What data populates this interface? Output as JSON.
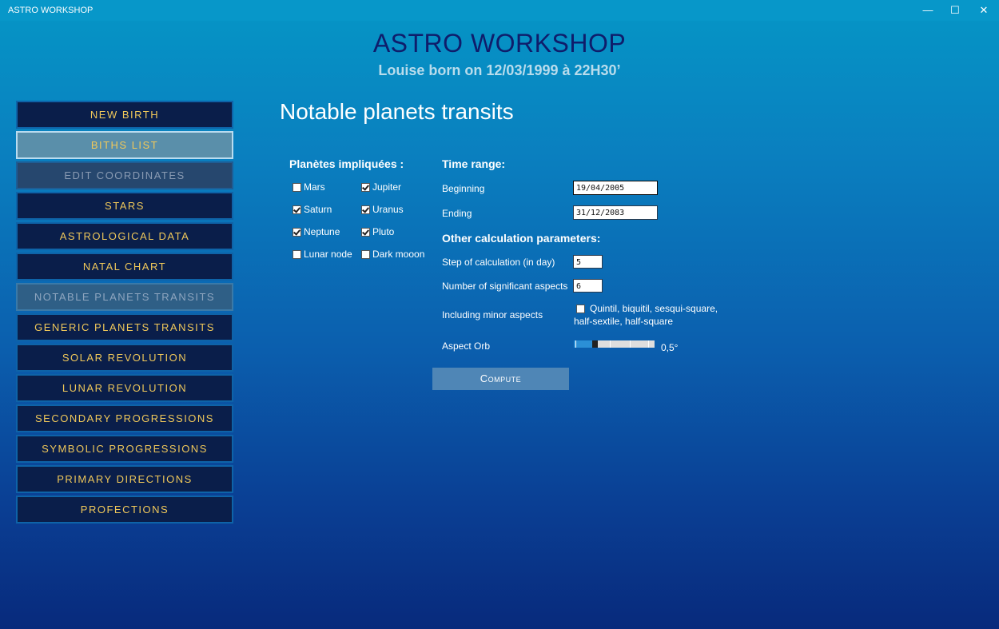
{
  "window": {
    "title": "ASTRO WORKSHOP",
    "minimize": "—",
    "maximize": "☐",
    "close": "✕"
  },
  "header": {
    "title": "ASTRO WORKSHOP",
    "subtitle": "Louise born on 12/03/1999 à 22H30’"
  },
  "nav": {
    "items": [
      {
        "label": "NEW BIRTH",
        "state": "normal"
      },
      {
        "label": "BITHS LIST",
        "state": "selected"
      },
      {
        "label": "EDIT COORDINATES",
        "state": "disabled"
      },
      {
        "label": "STARS",
        "state": "normal"
      },
      {
        "label": "ASTROLOGICAL DATA",
        "state": "normal"
      },
      {
        "label": "NATAL CHART",
        "state": "normal"
      },
      {
        "label": "NOTABLE PLANETS TRANSITS",
        "state": "current"
      },
      {
        "label": "GENERIC PLANETS TRANSITS",
        "state": "normal"
      },
      {
        "label": "SOLAR REVOLUTION",
        "state": "normal"
      },
      {
        "label": "LUNAR REVOLUTION",
        "state": "normal"
      },
      {
        "label": "SECONDARY PROGRESSIONS",
        "state": "normal"
      },
      {
        "label": "SYMBOLIC PROGRESSIONS",
        "state": "normal"
      },
      {
        "label": "PRIMARY DIRECTIONS",
        "state": "normal"
      },
      {
        "label": "PROFECTIONS",
        "state": "normal"
      }
    ]
  },
  "main": {
    "heading": "Notable planets transits",
    "planets": {
      "title": "Planètes impliquées :",
      "items": [
        {
          "label": "Mars",
          "checked": false
        },
        {
          "label": "Jupiter",
          "checked": true
        },
        {
          "label": "Saturn",
          "checked": true
        },
        {
          "label": "Uranus",
          "checked": true
        },
        {
          "label": "Neptune",
          "checked": true
        },
        {
          "label": "Pluto",
          "checked": true
        },
        {
          "label": "Lunar node",
          "checked": false
        },
        {
          "label": "Dark mooon",
          "checked": false
        }
      ]
    },
    "time_range": {
      "title": "Time range:",
      "beginning_label": "Beginning",
      "beginning_value": "19/04/2005",
      "ending_label": "Ending",
      "ending_value": "31/12/2083"
    },
    "params": {
      "title": "Other calculation parameters:",
      "step_label": "Step of calculation (in day)",
      "step_value": "5",
      "aspects_label": "Number of significant aspects",
      "aspects_value": "6",
      "minor_label": "Including minor aspects",
      "minor_checked": false,
      "minor_option_line1": "Quintil, biquitil, sesqui-square,",
      "minor_option_line2": "half-sextile, half-square",
      "orb_label": "Aspect Orb",
      "orb_value_text": "0,5°",
      "orb_fraction": 0.25
    },
    "compute_label": "Compute"
  }
}
